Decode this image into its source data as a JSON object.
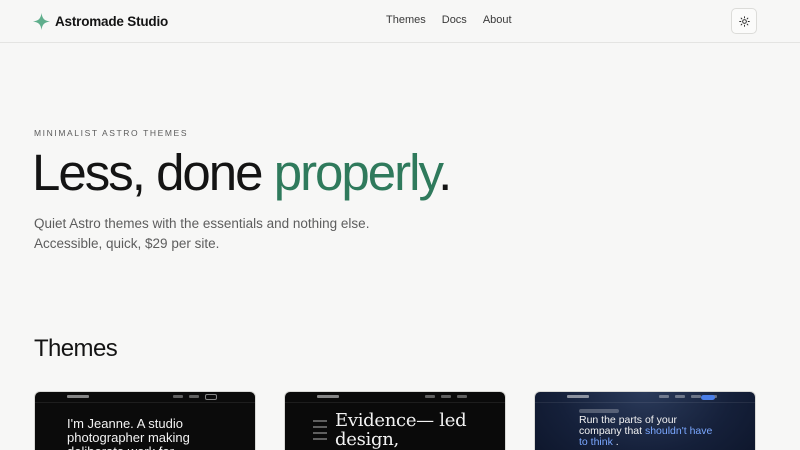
{
  "header": {
    "brand_name": "Astromade Studio",
    "nav": [
      "Themes",
      "Docs",
      "About"
    ],
    "theme_toggle_icon": "sun-icon"
  },
  "hero": {
    "eyebrow": "MINIMALIST ASTRO THEMES",
    "title_main": "Less, done ",
    "title_accent": "properly",
    "title_end": ".",
    "description": "Quiet Astro themes with the essentials and nothing else. Accessible, quick, $29 per site."
  },
  "themes": {
    "section_title": "Themes",
    "cards": [
      {
        "preview_text": "I'm Jeanne. A studio photographer making deliberate work for"
      },
      {
        "preview_text": "Evidence— led design,"
      },
      {
        "preview_text_lead": "Run the parts of your company that ",
        "preview_text_highlight": "shouldn't have to think",
        "preview_text_end": " ."
      }
    ]
  },
  "colors": {
    "accent": "#2f7a5c",
    "background": "#f7f7f6",
    "text": "#141414",
    "muted": "#5d5d5d"
  }
}
